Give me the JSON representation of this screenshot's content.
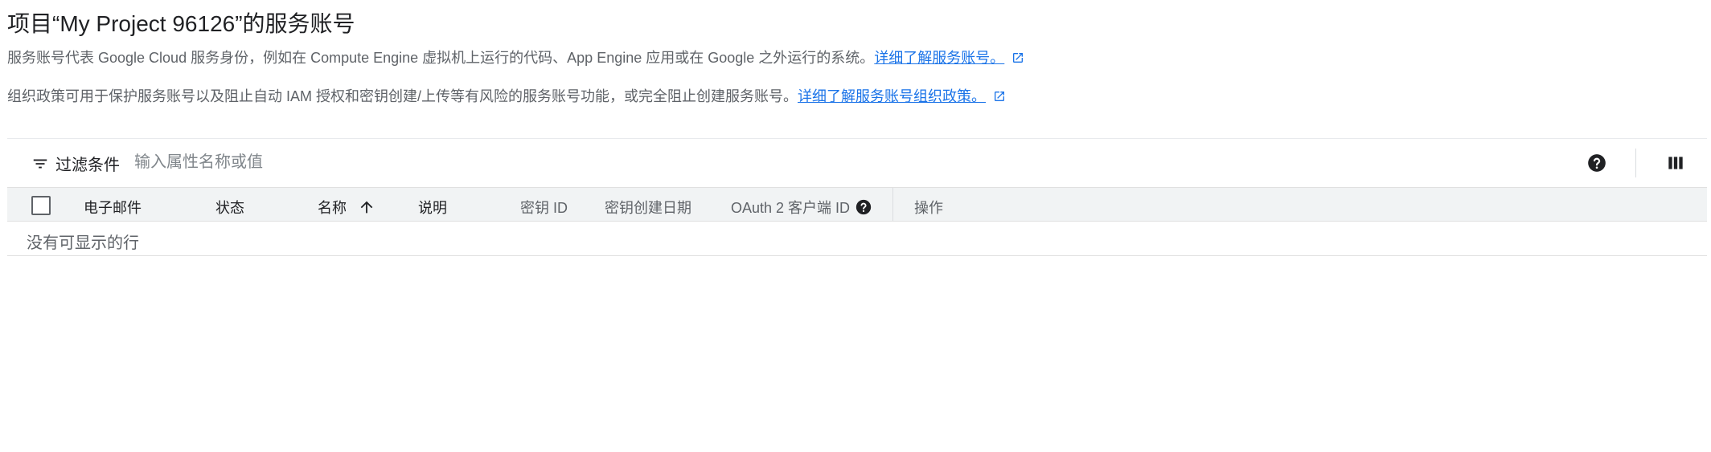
{
  "page": {
    "title": "项目“My Project 96126”的服务账号"
  },
  "descriptions": {
    "service_accounts_text": "服务账号代表 Google Cloud 服务身份，例如在 Compute Engine 虚拟机上运行的代码、App Engine 应用或在 Google 之外运行的系统。",
    "service_accounts_link": "详细了解服务账号。",
    "org_policy_text": "组织政策可用于保护服务账号以及阻止自动 IAM 授权和密钥创建/上传等有风险的服务账号功能，或完全阻止创建服务账号。",
    "org_policy_link": "详细了解服务账号组织政策。"
  },
  "toolbar": {
    "filter_label": "过滤条件",
    "filter_placeholder": "输入属性名称或值",
    "icons": [
      "filter-icon",
      "help-icon",
      "column-display-icon"
    ]
  },
  "table": {
    "columns": [
      {
        "label": "电子邮件"
      },
      {
        "label": "状态"
      },
      {
        "label": "名称",
        "sorted": "ascending"
      },
      {
        "label": "说明"
      },
      {
        "label": "密钥 ID"
      },
      {
        "label": "密钥创建日期"
      },
      {
        "label": "OAuth 2 客户端 ID"
      },
      {
        "label": "操作"
      }
    ],
    "empty_message": "没有可显示的行"
  },
  "colors": {
    "link": "#1a73e8",
    "header_bg": "#f1f3f4",
    "muted_text": "#5f6368"
  }
}
